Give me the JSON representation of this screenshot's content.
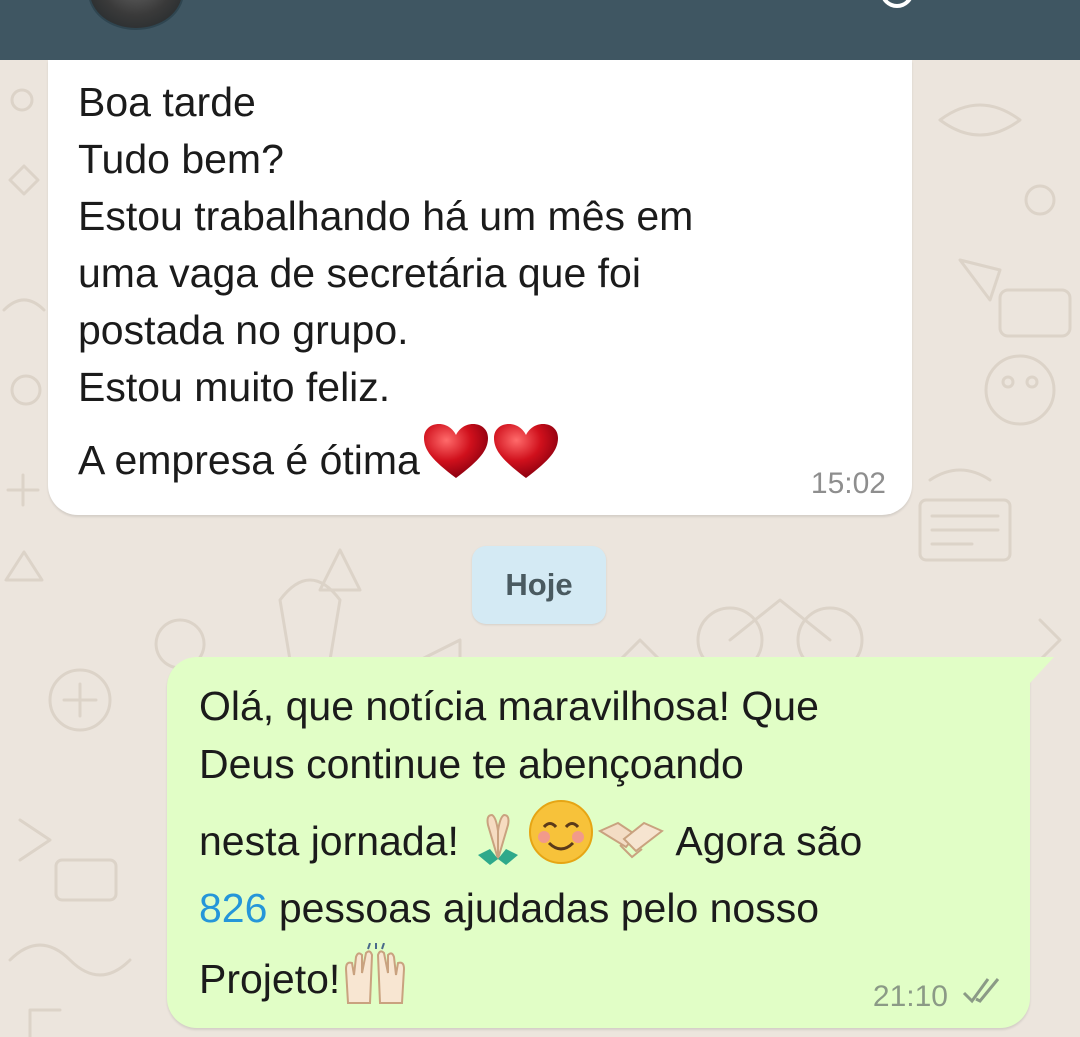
{
  "chat": {
    "incoming": {
      "lines": [
        "Boa tarde",
        "Tudo bem?",
        "Estou trabalhando há um mês em",
        "uma vaga de secretária que foi",
        "postada no grupo.",
        "Estou muito feliz.",
        "A empresa é ótima"
      ],
      "time": "15:02"
    },
    "date_chip": "Hoje",
    "outgoing": {
      "line1": "Olá, que notícia maravilhosa! Que",
      "line2": "Deus continue te abençoando",
      "line3_a": "nesta jornada! ",
      "line3_b": " Agora são",
      "line4_num": "826",
      "line4_rest": " pessoas ajudadas pelo nosso",
      "line5": "Projeto!",
      "time": "21:10"
    }
  },
  "icons": {
    "avatar": "contact-avatar",
    "heart": "red-heart-emoji",
    "pray": "folded-hands-emoji",
    "smile": "smiling-face-emoji",
    "handshake": "handshake-emoji",
    "raise": "raising-hands-emoji",
    "ticks": "double-check-icon"
  },
  "colors": {
    "header": "#3f5662",
    "wallpaper": "#ece5dd",
    "incoming_bubble": "#ffffff",
    "outgoing_bubble": "#e1fec6",
    "date_chip": "#d4eaf4",
    "link": "#2596d9"
  }
}
